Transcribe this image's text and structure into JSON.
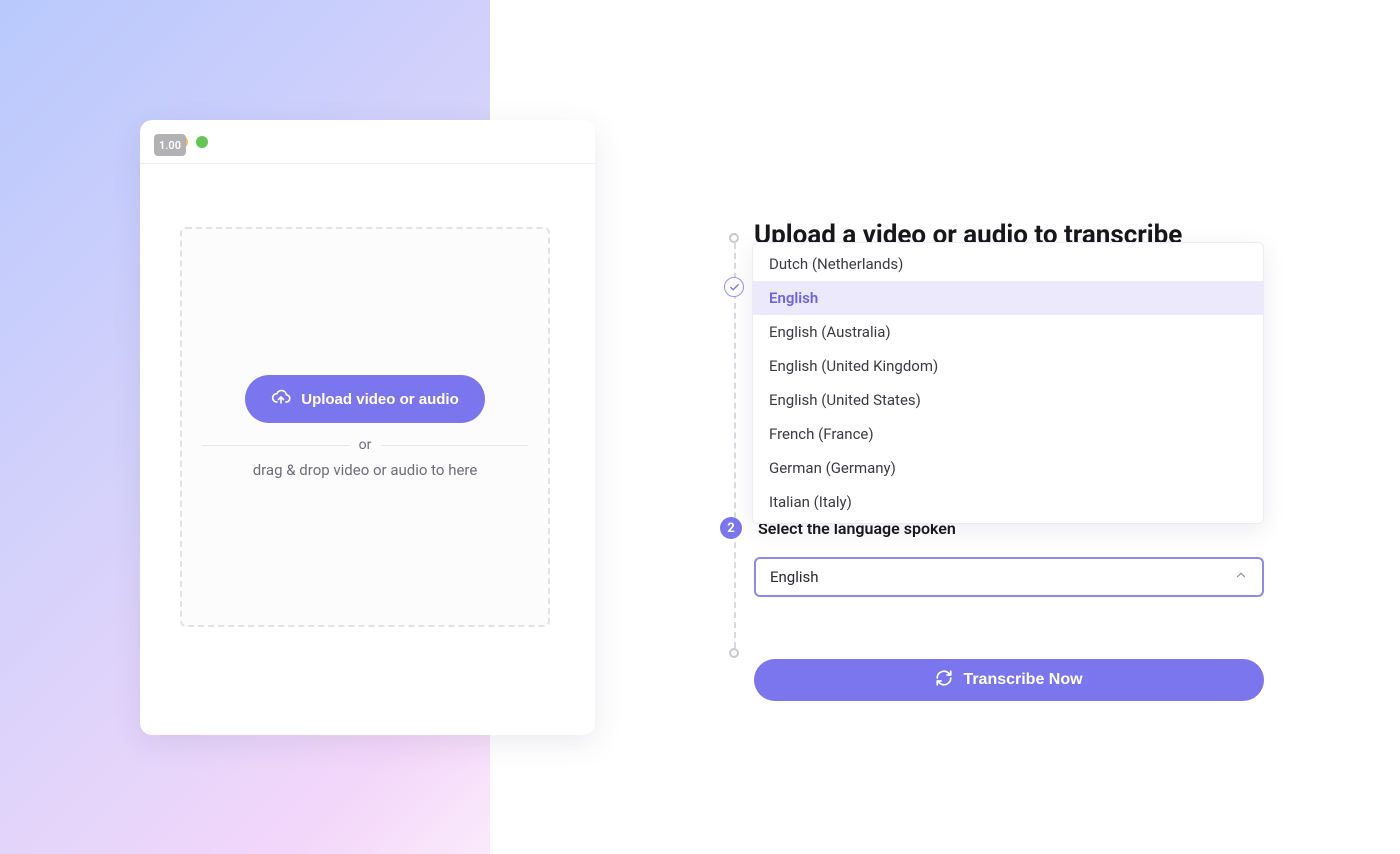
{
  "panel": {
    "badge_text": "1.00",
    "upload_button": "Upload video or audio",
    "divider": "or",
    "drop_hint": "drag & drop video or audio to here"
  },
  "steps": {
    "heading": "Upload a video or audio to transcribe",
    "step2_number": "2",
    "step2_label": "Select the language spoken",
    "selected_language": "English",
    "transcribe_button": "Transcribe Now"
  },
  "dropdown": {
    "options": [
      "Dutch (Netherlands)",
      "English",
      "English (Australia)",
      "English (United Kingdom)",
      "English (United States)",
      "French (France)",
      "German (Germany)",
      "Italian (Italy)"
    ],
    "selected_index": 1
  }
}
